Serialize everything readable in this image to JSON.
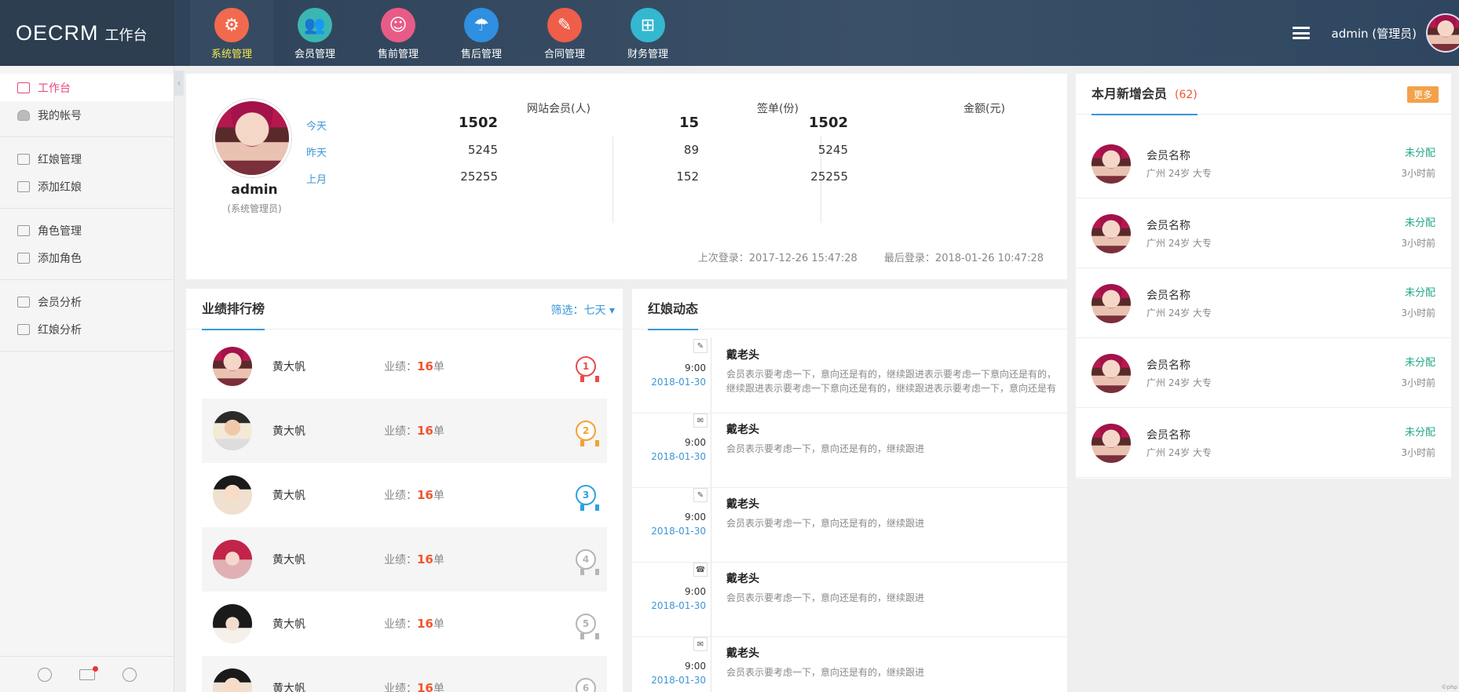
{
  "brand": {
    "name": "OECRM",
    "sub": "工作台"
  },
  "topnav": [
    {
      "label": "系统管理",
      "color": "#f26a4d",
      "icon": "gear-icon",
      "glyph": "⚙"
    },
    {
      "label": "会员管理",
      "color": "#3ab7b3",
      "icon": "users-icon",
      "glyph": "👥"
    },
    {
      "label": "售前管理",
      "color": "#e85b87",
      "icon": "face-icon",
      "glyph": "☺"
    },
    {
      "label": "售后管理",
      "color": "#2f8fe0",
      "icon": "umbrella-icon",
      "glyph": "☂"
    },
    {
      "label": "合同管理",
      "color": "#ef5e49",
      "icon": "contract-icon",
      "glyph": "✎"
    },
    {
      "label": "财务管理",
      "color": "#34b8cf",
      "icon": "presentation-icon",
      "glyph": "⊞"
    }
  ],
  "user": {
    "display": "admin (管理员)"
  },
  "sidebar": [
    [
      {
        "label": "工作台",
        "active": true
      },
      {
        "label": "我的帐号"
      }
    ],
    [
      {
        "label": "红娘管理"
      },
      {
        "label": "添加红娘"
      }
    ],
    [
      {
        "label": "角色管理"
      },
      {
        "label": "添加角色"
      }
    ],
    [
      {
        "label": "会员分析"
      },
      {
        "label": "红娘分析"
      }
    ]
  ],
  "profile": {
    "name": "admin",
    "role": "(系统管理员)",
    "cols": [
      "网站会员(人)",
      "签单(份)",
      "金额(元)"
    ],
    "rows": [
      {
        "label": "今天",
        "values": [
          "1502",
          "15",
          "1502"
        ]
      },
      {
        "label": "昨天",
        "values": [
          "5245",
          "89",
          "5245"
        ]
      },
      {
        "label": "上月",
        "values": [
          "25255",
          "152",
          "25255"
        ]
      }
    ],
    "last_login": "上次登录：2017-12-26 15:47:28",
    "latest_login": "最后登录：2018-01-26 10:47:28"
  },
  "rank": {
    "title": "业绩排行榜",
    "filter": "筛选：七天 ▾",
    "items": [
      {
        "name": "黄大帆",
        "perf_label": "业绩：",
        "perf": "16",
        "unit": "单",
        "rank": "1",
        "color": "#e84c4c"
      },
      {
        "name": "黄大帆",
        "perf_label": "业绩：",
        "perf": "16",
        "unit": "单",
        "rank": "2",
        "color": "#f5a030"
      },
      {
        "name": "黄大帆",
        "perf_label": "业绩：",
        "perf": "16",
        "unit": "单",
        "rank": "3",
        "color": "#2aa3e0"
      },
      {
        "name": "黄大帆",
        "perf_label": "业绩：",
        "perf": "16",
        "unit": "单",
        "rank": "4",
        "color": "#b5b5b5"
      },
      {
        "name": "黄大帆",
        "perf_label": "业绩：",
        "perf": "16",
        "unit": "单",
        "rank": "5",
        "color": "#b5b5b5"
      },
      {
        "name": "黄大帆",
        "perf_label": "业绩：",
        "perf": "16",
        "unit": "单",
        "rank": "6",
        "color": "#b5b5b5"
      }
    ]
  },
  "news": {
    "title": "红娘动态",
    "items": [
      {
        "time": "9:00",
        "date": "2018-01-30",
        "icon": "pencil-icon",
        "glyph": "✎",
        "name": "戴老头",
        "text": "会员表示要考虑一下，意向还是有的，继续跟进表示要考虑一下意向还是有的，继续跟进表示要考虑一下意向还是有的，继续跟进表示要考虑一下，意向还是有"
      },
      {
        "time": "9:00",
        "date": "2018-01-30",
        "icon": "chat-icon",
        "glyph": "✉",
        "name": "戴老头",
        "text": "会员表示要考虑一下，意向还是有的，继续跟进"
      },
      {
        "time": "9:00",
        "date": "2018-01-30",
        "icon": "pencil-icon",
        "glyph": "✎",
        "name": "戴老头",
        "text": "会员表示要考虑一下，意向还是有的，继续跟进"
      },
      {
        "time": "9:00",
        "date": "2018-01-30",
        "icon": "phone-icon",
        "glyph": "☎",
        "name": "戴老头",
        "text": "会员表示要考虑一下，意向还是有的，继续跟进"
      },
      {
        "time": "9:00",
        "date": "2018-01-30",
        "icon": "chat-icon",
        "glyph": "✉",
        "name": "戴老头",
        "text": "会员表示要考虑一下，意向还是有的，继续跟进"
      }
    ]
  },
  "members": {
    "title": "本月新增会员",
    "count": "(62)",
    "more": "更多",
    "items": [
      {
        "name": "会员名称",
        "info": "广州 24岁 大专",
        "status": "未分配",
        "time": "3小时前"
      },
      {
        "name": "会员名称",
        "info": "广州 24岁 大专",
        "status": "未分配",
        "time": "3小时前"
      },
      {
        "name": "会员名称",
        "info": "广州 24岁 大专",
        "status": "未分配",
        "time": "3小时前"
      },
      {
        "name": "会员名称",
        "info": "广州 24岁 大专",
        "status": "未分配",
        "time": "3小时前"
      },
      {
        "name": "会员名称",
        "info": "广州 24岁 大专",
        "status": "未分配",
        "time": "3小时前"
      }
    ]
  },
  "corner": "©php"
}
